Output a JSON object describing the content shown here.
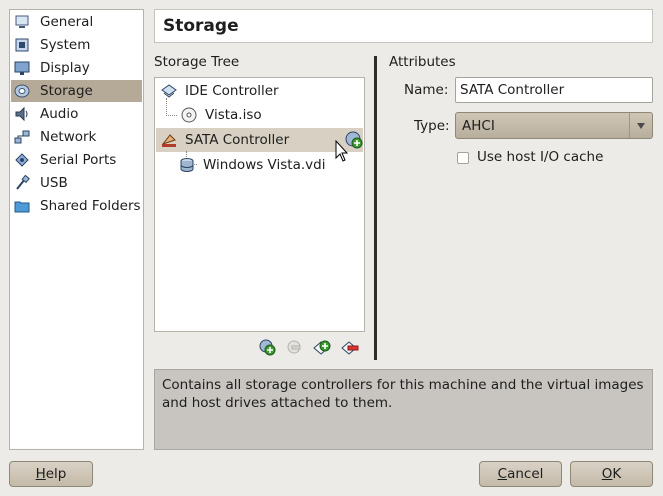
{
  "sidebar": {
    "items": [
      {
        "label": "General",
        "icon": "general-icon"
      },
      {
        "label": "System",
        "icon": "system-icon"
      },
      {
        "label": "Display",
        "icon": "display-icon"
      },
      {
        "label": "Storage",
        "icon": "storage-icon",
        "selected": true
      },
      {
        "label": "Audio",
        "icon": "audio-icon"
      },
      {
        "label": "Network",
        "icon": "network-icon"
      },
      {
        "label": "Serial Ports",
        "icon": "serial-ports-icon"
      },
      {
        "label": "USB",
        "icon": "usb-icon"
      },
      {
        "label": "Shared Folders",
        "icon": "shared-folders-icon"
      }
    ]
  },
  "header": {
    "title": "Storage"
  },
  "storage_tree": {
    "label": "Storage Tree",
    "items": [
      {
        "label": "IDE Controller",
        "type": "controller"
      },
      {
        "label": "Vista.iso",
        "type": "cd-image"
      },
      {
        "label": "SATA Controller",
        "type": "controller",
        "selected": true
      },
      {
        "label": "Windows Vista.vdi",
        "type": "hard-disk"
      }
    ]
  },
  "attributes": {
    "label": "Attributes",
    "name_label": "Name:",
    "name_value": "SATA Controller",
    "type_label": "Type:",
    "type_value": "AHCI",
    "host_io_cache_label": "Use host I/O cache",
    "host_io_cache_checked": false
  },
  "description": "Contains all storage controllers for this machine and the virtual images and host drives attached to them.",
  "buttons": {
    "help_mnemonic": "H",
    "help_rest": "elp",
    "cancel_mnemonic": "C",
    "cancel_rest": "ancel",
    "ok_mnemonic": "O",
    "ok_rest": "K"
  },
  "colors": {
    "selection": "#b5aa98",
    "tree_selection": "#d8d0c3",
    "background": "#edebe7"
  }
}
